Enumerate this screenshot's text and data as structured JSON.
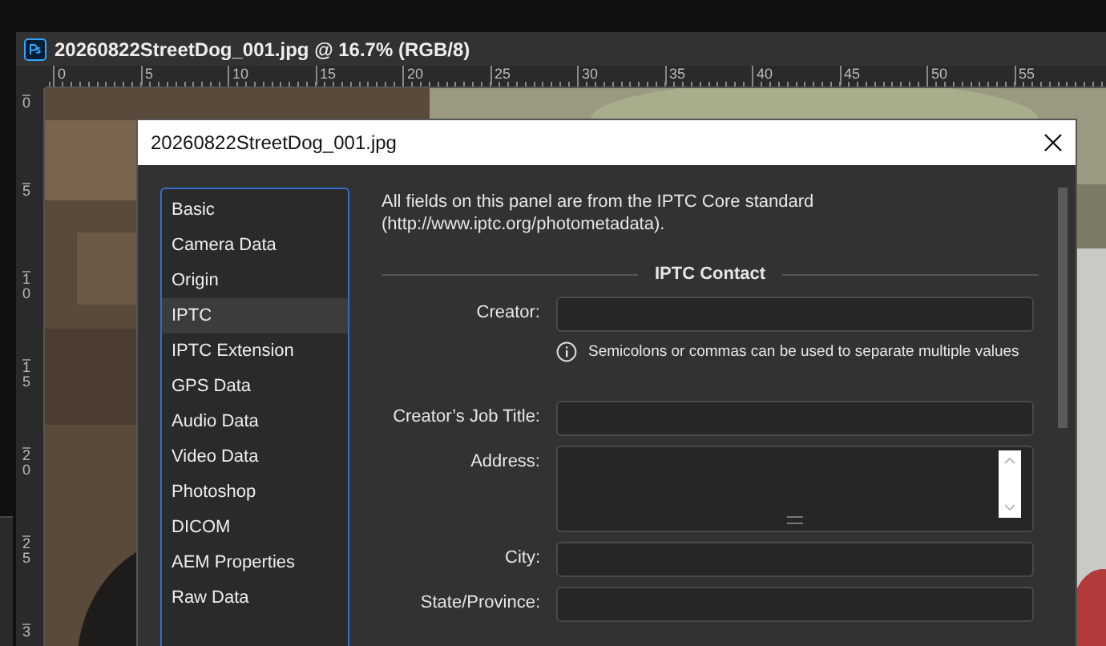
{
  "document": {
    "title": "20260822StreetDog_001.jpg @ 16.7% (RGB/8)"
  },
  "rulers": {
    "horizontal": [
      "0",
      "5",
      "10",
      "15",
      "20",
      "25",
      "30",
      "35",
      "40",
      "45",
      "50",
      "55"
    ],
    "vertical": [
      "0",
      "5",
      "10",
      "15",
      "20",
      "25",
      "3"
    ]
  },
  "dialog": {
    "title": "20260822StreetDog_001.jpg",
    "categories": [
      {
        "label": "Basic",
        "selected": false
      },
      {
        "label": "Camera Data",
        "selected": false
      },
      {
        "label": "Origin",
        "selected": false
      },
      {
        "label": "IPTC",
        "selected": true
      },
      {
        "label": "IPTC Extension",
        "selected": false
      },
      {
        "label": "GPS Data",
        "selected": false
      },
      {
        "label": "Audio Data",
        "selected": false
      },
      {
        "label": "Video Data",
        "selected": false
      },
      {
        "label": "Photoshop",
        "selected": false
      },
      {
        "label": "DICOM",
        "selected": false
      },
      {
        "label": "AEM Properties",
        "selected": false
      },
      {
        "label": "Raw Data",
        "selected": false
      }
    ],
    "intro": "All fields on this panel are from the IPTC Core standard (http://www.iptc.org/photometadata).",
    "section": "IPTC Contact",
    "fields": [
      {
        "label": "Creator:",
        "kind": "text",
        "hint": "Semicolons or commas can be used to separate multiple values"
      },
      {
        "label": "Creator’s Job Title:",
        "kind": "text"
      },
      {
        "label": "Address:",
        "kind": "multiline"
      },
      {
        "label": "City:",
        "kind": "text"
      },
      {
        "label": "State/Province:",
        "kind": "text"
      }
    ]
  }
}
